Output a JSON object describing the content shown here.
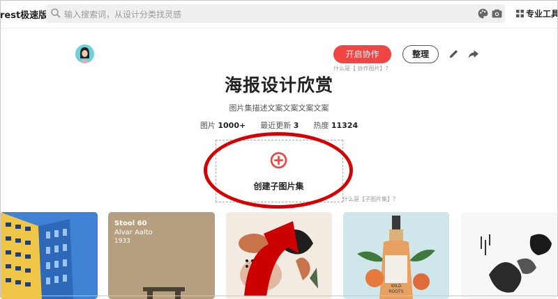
{
  "header": {
    "brand": "rest极速版",
    "search_placeholder": "输入搜索词，从设计分类找灵感",
    "pro_tools": "专业工具",
    "icons": [
      "search-icon",
      "palette-icon",
      "camera-icon",
      "grid-icon"
    ]
  },
  "board": {
    "collab_button": "开启协作",
    "organize_button": "整理",
    "collab_hint": "什么是【 协作图片】?",
    "title": "海报设计欣赏",
    "description": "图片集描述文案文案文案文案",
    "stats": {
      "images_label": "图片",
      "images_value": "1000+",
      "updated_label": "最近更新",
      "updated_value": "3",
      "heat_label": "热度",
      "heat_value": "11324"
    },
    "create_sub": "创建子图片集",
    "sub_hint": "什么是【子图片集】?",
    "accent": "#ef4644",
    "annotation_color": "#d50000"
  },
  "cards": [
    {
      "name": "blue-building"
    },
    {
      "name": "stool-poster",
      "line1": "Stool 60",
      "line2": "Alvar Aalto",
      "line3": "1933"
    },
    {
      "name": "abstract-shapes"
    },
    {
      "name": "wild-roots-bottle"
    },
    {
      "name": "ink-art"
    }
  ]
}
